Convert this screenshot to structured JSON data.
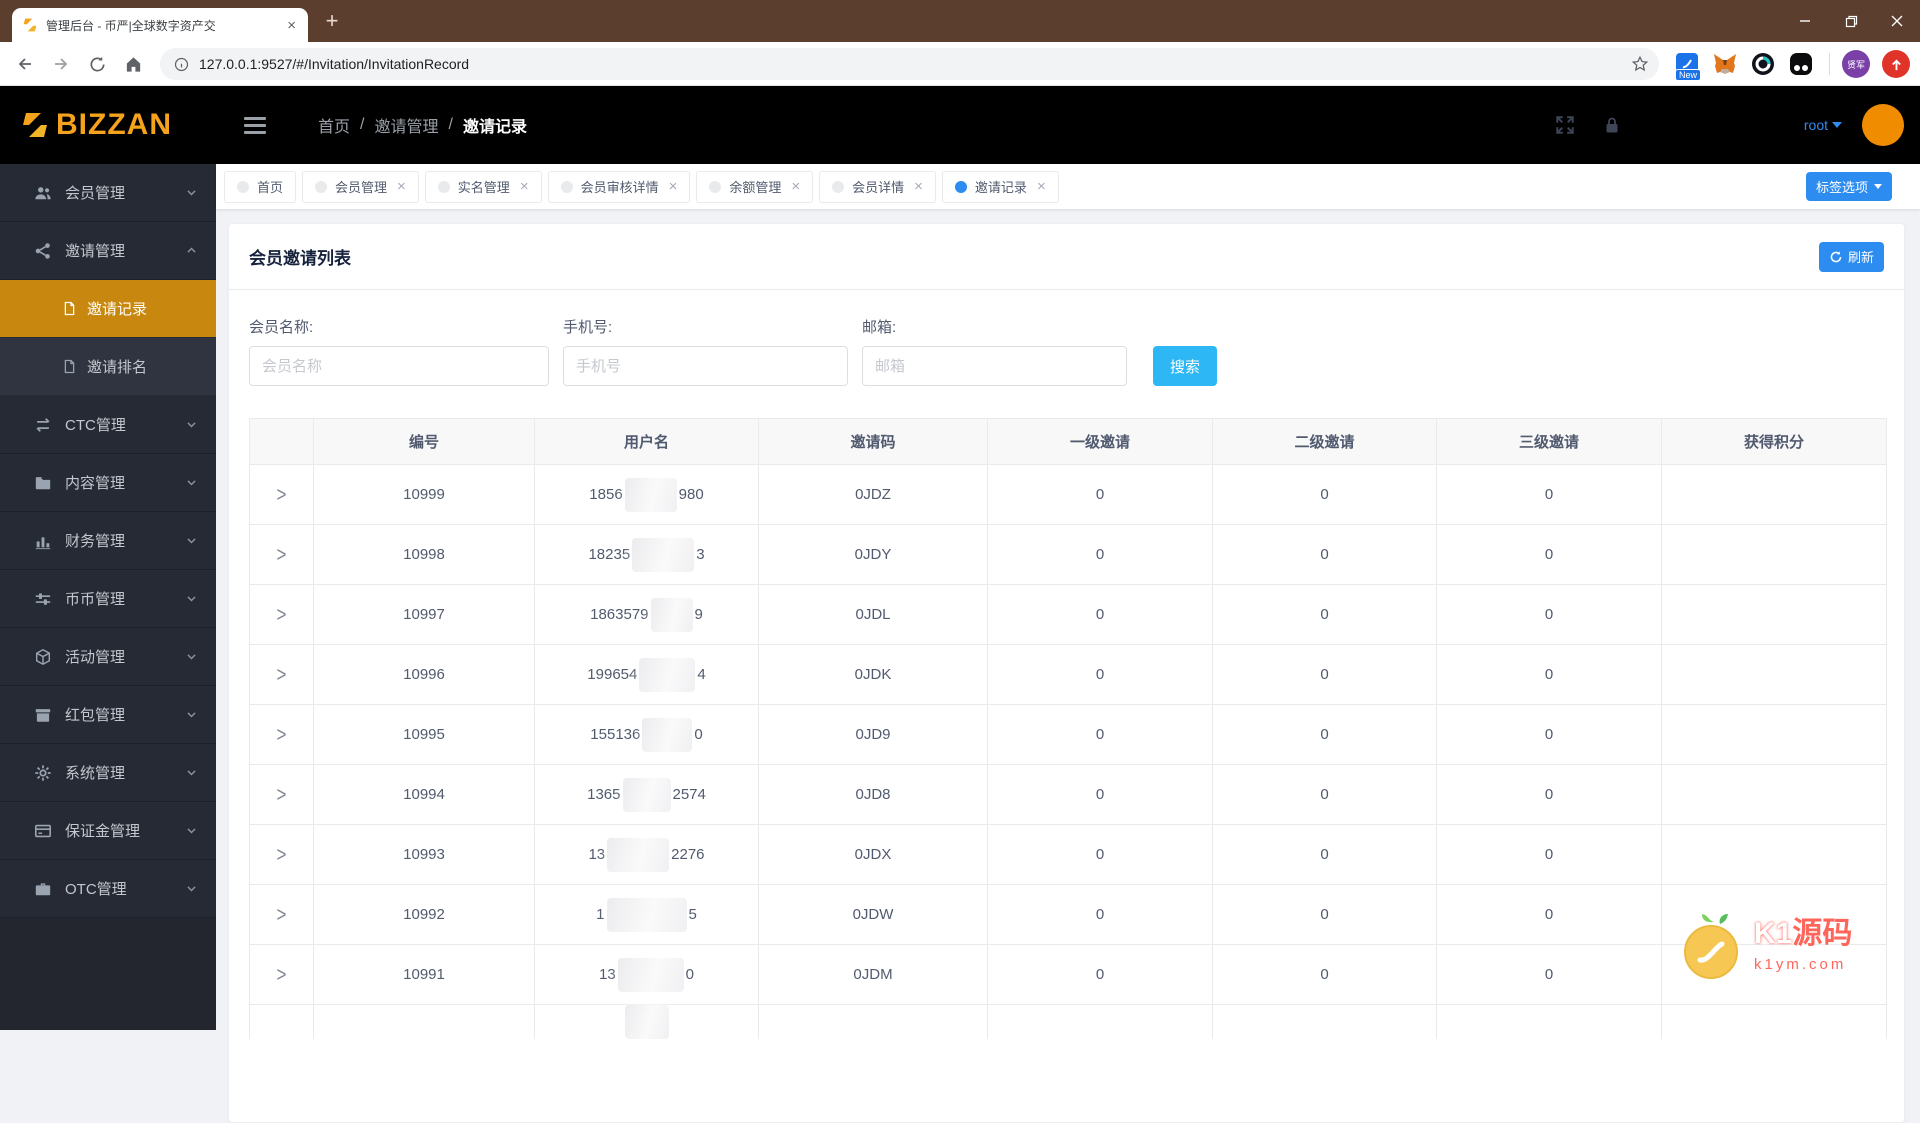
{
  "browser": {
    "tab_title": "管理后台 - 币严|全球数字资产交",
    "url": "127.0.0.1:9527/#/Invitation/InvitationRecord",
    "ext_badge": "New",
    "profile_badge": "贤军"
  },
  "navbar": {
    "logo": "BIZZAN",
    "breadcrumb": [
      "首页",
      "邀请管理",
      "邀请记录"
    ],
    "user": "root"
  },
  "tabbar": {
    "options_label": "标签选项",
    "tabs": [
      {
        "label": "首页",
        "closable": false,
        "active": false
      },
      {
        "label": "会员管理",
        "closable": true,
        "active": false
      },
      {
        "label": "实名管理",
        "closable": true,
        "active": false
      },
      {
        "label": "会员审核详情",
        "closable": true,
        "active": false
      },
      {
        "label": "余额管理",
        "closable": true,
        "active": false
      },
      {
        "label": "会员详情",
        "closable": true,
        "active": false
      },
      {
        "label": "邀请记录",
        "closable": true,
        "active": true
      }
    ]
  },
  "sidebar": {
    "items": [
      {
        "label": "会员管理",
        "icon": "users-icon",
        "expanded": false
      },
      {
        "label": "邀请管理",
        "icon": "share-icon",
        "expanded": true,
        "children": [
          {
            "label": "邀请记录",
            "icon": "file-icon",
            "active": true
          },
          {
            "label": "邀请排名",
            "icon": "file-icon",
            "active": false
          }
        ]
      },
      {
        "label": "CTC管理",
        "icon": "swap-icon",
        "expanded": false
      },
      {
        "label": "内容管理",
        "icon": "folder-icon",
        "expanded": false
      },
      {
        "label": "财务管理",
        "icon": "chart-icon",
        "expanded": false
      },
      {
        "label": "币币管理",
        "icon": "sliders-icon",
        "expanded": false
      },
      {
        "label": "活动管理",
        "icon": "cube-icon",
        "expanded": false
      },
      {
        "label": "红包管理",
        "icon": "box-icon",
        "expanded": false
      },
      {
        "label": "系统管理",
        "icon": "gear-icon",
        "expanded": false
      },
      {
        "label": "保证金管理",
        "icon": "card-icon",
        "expanded": false
      },
      {
        "label": "OTC管理",
        "icon": "briefcase-icon",
        "expanded": false
      }
    ]
  },
  "panel": {
    "title": "会员邀请列表",
    "refresh_label": "刷新",
    "search": {
      "fields": [
        {
          "label": "会员名称:",
          "placeholder": "会员名称"
        },
        {
          "label": "手机号:",
          "placeholder": "手机号"
        },
        {
          "label": "邮箱:",
          "placeholder": "邮箱"
        }
      ],
      "button_label": "搜索"
    },
    "table": {
      "columns": [
        "",
        "编号",
        "用户名",
        "邀请码",
        "一级邀请",
        "二级邀请",
        "三级邀请",
        "获得积分"
      ],
      "rows": [
        {
          "id": "10999",
          "user_pre": "1856",
          "user_post": "980",
          "blur": 52,
          "code": "0JDZ",
          "l1": "0",
          "l2": "0",
          "l3": "0",
          "points": ""
        },
        {
          "id": "10998",
          "user_pre": "18235",
          "user_post": "3",
          "blur": 62,
          "code": "0JDY",
          "l1": "0",
          "l2": "0",
          "l3": "0",
          "points": ""
        },
        {
          "id": "10997",
          "user_pre": "1863579",
          "user_post": "9",
          "blur": 42,
          "code": "0JDL",
          "l1": "0",
          "l2": "0",
          "l3": "0",
          "points": ""
        },
        {
          "id": "10996",
          "user_pre": "199654",
          "user_post": "4",
          "blur": 56,
          "code": "0JDK",
          "l1": "0",
          "l2": "0",
          "l3": "0",
          "points": ""
        },
        {
          "id": "10995",
          "user_pre": "155136",
          "user_post": "0",
          "blur": 50,
          "code": "0JD9",
          "l1": "0",
          "l2": "0",
          "l3": "0",
          "points": ""
        },
        {
          "id": "10994",
          "user_pre": "1365",
          "user_post": "2574",
          "blur": 48,
          "code": "0JD8",
          "l1": "0",
          "l2": "0",
          "l3": "0",
          "points": ""
        },
        {
          "id": "10993",
          "user_pre": "13",
          "user_post": "2276",
          "blur": 62,
          "code": "0JDX",
          "l1": "0",
          "l2": "0",
          "l3": "0",
          "points": ""
        },
        {
          "id": "10992",
          "user_pre": "1",
          "user_post": "5",
          "blur": 80,
          "code": "0JDW",
          "l1": "0",
          "l2": "0",
          "l3": "0",
          "points": ""
        },
        {
          "id": "10991",
          "user_pre": "13",
          "user_post": "0",
          "blur": 66,
          "code": "0JDM",
          "l1": "0",
          "l2": "0",
          "l3": "0",
          "points": ""
        },
        {
          "id": "",
          "user_pre": "",
          "user_post": "",
          "blur": 44,
          "code": "",
          "l1": "",
          "l2": "",
          "l3": "",
          "points": "",
          "partial": true
        }
      ]
    }
  },
  "watermark": {
    "title_k1": "K1",
    "title_rest": "源码",
    "domain": "k1ym.com"
  },
  "colors": {
    "primary": "#2d8cf0",
    "info": "#2db7f5",
    "sidebar_active": "#c8870e",
    "logo_gold": "#f5a31d",
    "avatar_orange": "#f08c00",
    "chrome_brown": "#5c3e2f"
  }
}
